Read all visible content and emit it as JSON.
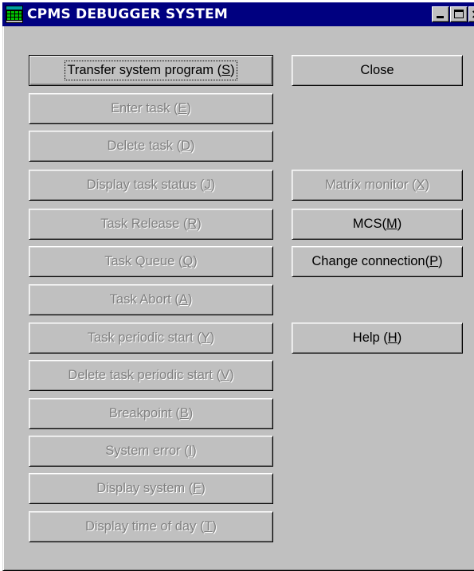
{
  "window": {
    "title": "CPMS DEBUGGER SYSTEM",
    "app_icon": "grid-window-icon",
    "caption_buttons": {
      "minimize": "minimize-icon",
      "maximize": "maximize-icon",
      "close": "×"
    }
  },
  "left_buttons": [
    {
      "pre": "Transfer system program (",
      "key": "S",
      "post": ")",
      "enabled": true,
      "focused": true
    },
    {
      "pre": "Enter task (",
      "key": "E",
      "post": ")",
      "enabled": false
    },
    {
      "pre": "Delete task (",
      "key": "D",
      "post": ")",
      "enabled": false
    },
    {
      "pre": "Display task status (",
      "key": "J",
      "post": ")",
      "enabled": false
    },
    {
      "pre": "Task Release (",
      "key": "R",
      "post": ")",
      "enabled": false
    },
    {
      "pre": "Task Queue (",
      "key": "Q",
      "post": ")",
      "enabled": false
    },
    {
      "pre": "Task Abort (",
      "key": "A",
      "post": ")",
      "enabled": false
    },
    {
      "pre": "Task periodic start (",
      "key": "Y",
      "post": ")",
      "enabled": false
    },
    {
      "pre": "Delete task periodic start (",
      "key": "V",
      "post": ")",
      "enabled": false
    },
    {
      "pre": "Breakpoint (",
      "key": "B",
      "post": ")",
      "enabled": false
    },
    {
      "pre": "System error (",
      "key": "I",
      "post": ")",
      "enabled": false
    },
    {
      "pre": "Display system (",
      "key": "F",
      "post": ")",
      "enabled": false
    },
    {
      "pre": "Display time of day (",
      "key": "T",
      "post": ")",
      "enabled": false
    }
  ],
  "right_buttons": {
    "close": {
      "pre": "Close",
      "key": "",
      "post": "",
      "enabled": true
    },
    "matrix_monitor": {
      "pre": "Matrix monitor (",
      "key": "X",
      "post": ")",
      "enabled": false
    },
    "mcs": {
      "pre": "MCS(",
      "key": "M",
      "post": ")",
      "enabled": true
    },
    "change_connection": {
      "pre": "Change connection(",
      "key": "P",
      "post": ")",
      "enabled": true
    },
    "help": {
      "pre": "Help (",
      "key": "H",
      "post": ")",
      "enabled": true
    }
  }
}
